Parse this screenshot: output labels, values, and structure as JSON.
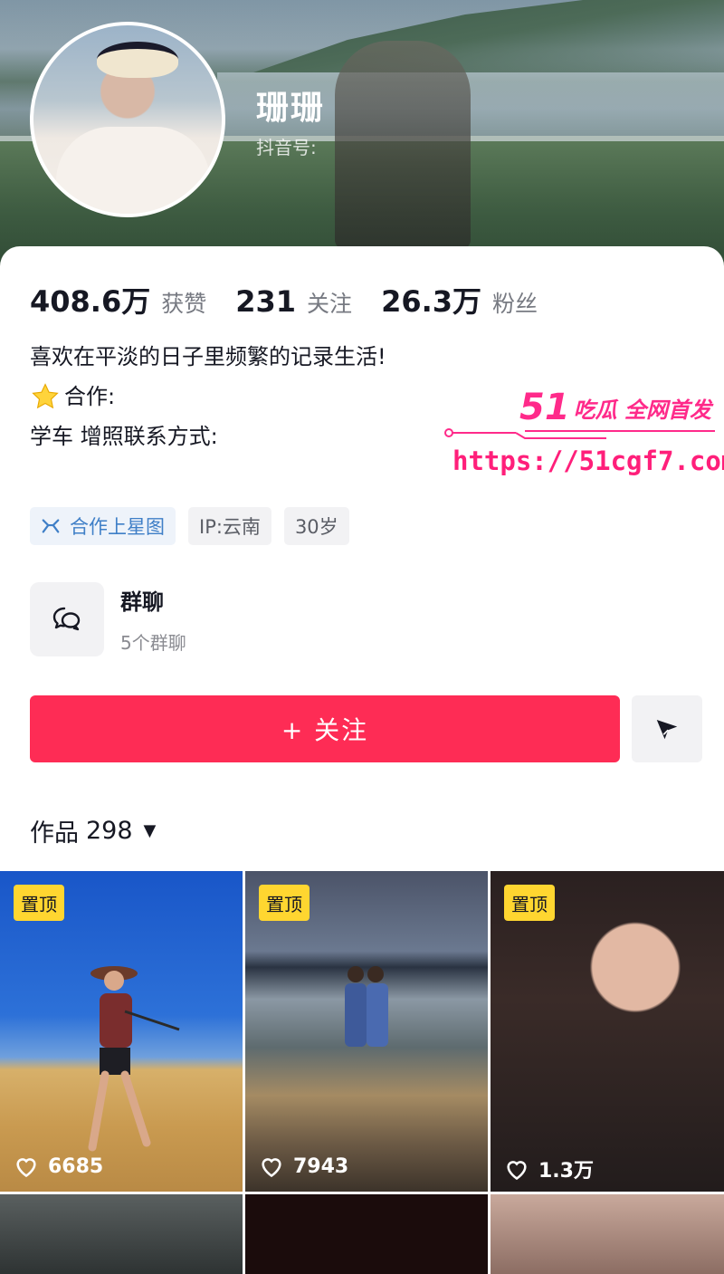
{
  "profile": {
    "nickname": "珊珊",
    "douyin_id_label": "抖音号:"
  },
  "stats": [
    {
      "value": "408.6万",
      "label": "获赞"
    },
    {
      "value": "231",
      "label": "关注"
    },
    {
      "value": "26.3万",
      "label": "粉丝"
    }
  ],
  "bio": {
    "line1": "喜欢在平淡的日子里频繁的记录生活!",
    "line2": "合作:",
    "line3": "学车 增照联系方式:"
  },
  "tags": {
    "star_map": "合作上星图",
    "ip": "IP:云南",
    "age": "30岁"
  },
  "group_chat": {
    "title": "群聊",
    "subtitle": "5个群聊"
  },
  "buttons": {
    "follow": "+ 关注"
  },
  "works": {
    "label": "作品",
    "count": "298"
  },
  "watermark": {
    "brand_num": "51",
    "brand_text": "吃瓜 全网首发",
    "url": "https://51cgf7.com"
  },
  "videos": [
    {
      "pinned": "置顶",
      "likes": "6685"
    },
    {
      "pinned": "置顶",
      "likes": "7943"
    },
    {
      "pinned": "置顶",
      "likes": "1.3万"
    }
  ],
  "colors": {
    "follow_red": "#fe2c55",
    "pin_yellow": "#ffd630",
    "watermark_pink": "#ff2a8a"
  }
}
